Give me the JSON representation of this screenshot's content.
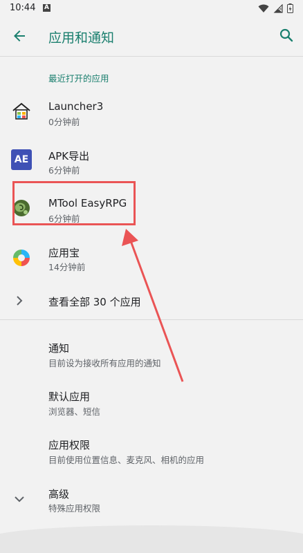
{
  "status_bar": {
    "time": "10:44",
    "notif_badge": "A"
  },
  "app_bar": {
    "title": "应用和通知"
  },
  "recent_section": {
    "header": "最近打开的应用",
    "apps": [
      {
        "name": "Launcher3",
        "time": "0分钟前",
        "icon": "launcher-house-icon"
      },
      {
        "name": "APK导出",
        "time": "6分钟前",
        "icon": "ae-icon",
        "icon_text": "AE"
      },
      {
        "name": "MTool EasyRPG",
        "time": "6分钟前",
        "icon": "mtool-icon"
      },
      {
        "name": "应用宝",
        "time": "14分钟前",
        "icon": "yingyongbao-icon"
      }
    ],
    "see_all": "查看全部 30 个应用"
  },
  "settings": [
    {
      "title": "通知",
      "subtitle": "目前设为接收所有应用的通知"
    },
    {
      "title": "默认应用",
      "subtitle": "浏览器、短信"
    },
    {
      "title": "应用权限",
      "subtitle": "目前使用位置信息、麦克风、相机的应用"
    },
    {
      "title": "高级",
      "subtitle": "特殊应用权限"
    }
  ],
  "colors": {
    "accent": "#1a7f6e",
    "annotation": "#ea5455",
    "background": "#f2f2f2"
  }
}
